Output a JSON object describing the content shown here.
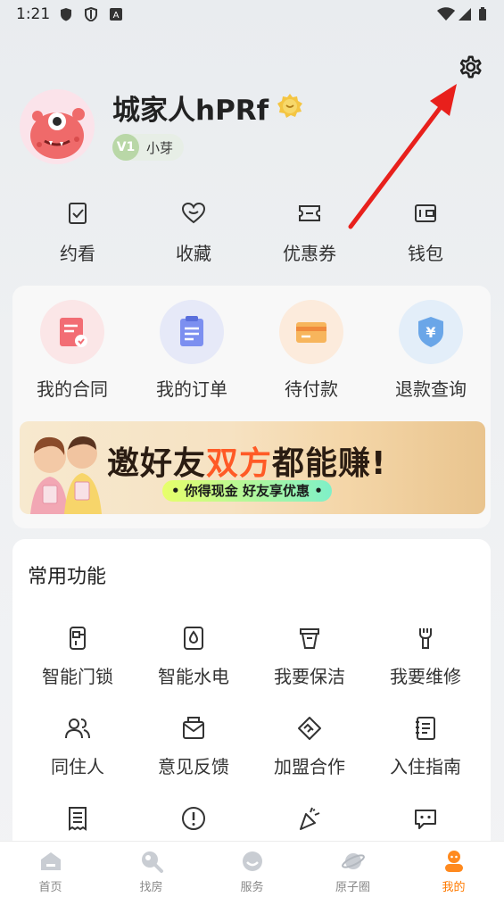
{
  "status_bar": {
    "time": "1:21"
  },
  "profile": {
    "username": "城家人hPRf",
    "level_badge": "V1",
    "level_name": "小芽"
  },
  "quick_actions": [
    {
      "label": "约看",
      "icon": "bookmark-check-icon"
    },
    {
      "label": "收藏",
      "icon": "heart-icon"
    },
    {
      "label": "优惠券",
      "icon": "coupon-icon"
    },
    {
      "label": "钱包",
      "icon": "wallet-icon"
    }
  ],
  "orders": [
    {
      "label": "我的合同",
      "icon": "contract-icon"
    },
    {
      "label": "我的订单",
      "icon": "order-icon"
    },
    {
      "label": "待付款",
      "icon": "card-icon"
    },
    {
      "label": "退款查询",
      "icon": "refund-shield-icon"
    }
  ],
  "banner": {
    "part1": "邀好友",
    "part2": "双方",
    "part3": "都能赚!",
    "subtitle": "• 你得现金 好友享优惠 •"
  },
  "common": {
    "title": "常用功能",
    "items": [
      {
        "label": "智能门锁",
        "icon": "smart-lock-icon"
      },
      {
        "label": "智能水电",
        "icon": "water-electric-icon"
      },
      {
        "label": "我要保洁",
        "icon": "cleaning-icon"
      },
      {
        "label": "我要维修",
        "icon": "repair-icon"
      },
      {
        "label": "同住人",
        "icon": "roommates-icon"
      },
      {
        "label": "意见反馈",
        "icon": "feedback-icon"
      },
      {
        "label": "加盟合作",
        "icon": "handshake-icon"
      },
      {
        "label": "入住指南",
        "icon": "guide-icon"
      },
      {
        "label": "",
        "icon": "receipt-icon"
      },
      {
        "label": "",
        "icon": "alert-icon"
      },
      {
        "label": "",
        "icon": "party-icon"
      },
      {
        "label": "",
        "icon": "chat-icon"
      }
    ]
  },
  "bottom_nav": [
    {
      "label": "首页",
      "icon": "home-icon"
    },
    {
      "label": "找房",
      "icon": "search-house-icon"
    },
    {
      "label": "服务",
      "icon": "service-icon"
    },
    {
      "label": "原子圈",
      "icon": "planet-icon"
    },
    {
      "label": "我的",
      "icon": "profile-icon",
      "active": true
    }
  ],
  "colors": {
    "accent": "#ff7a00",
    "annotation_arrow": "#e8201c",
    "banner_highlight": "#ff5a26"
  }
}
